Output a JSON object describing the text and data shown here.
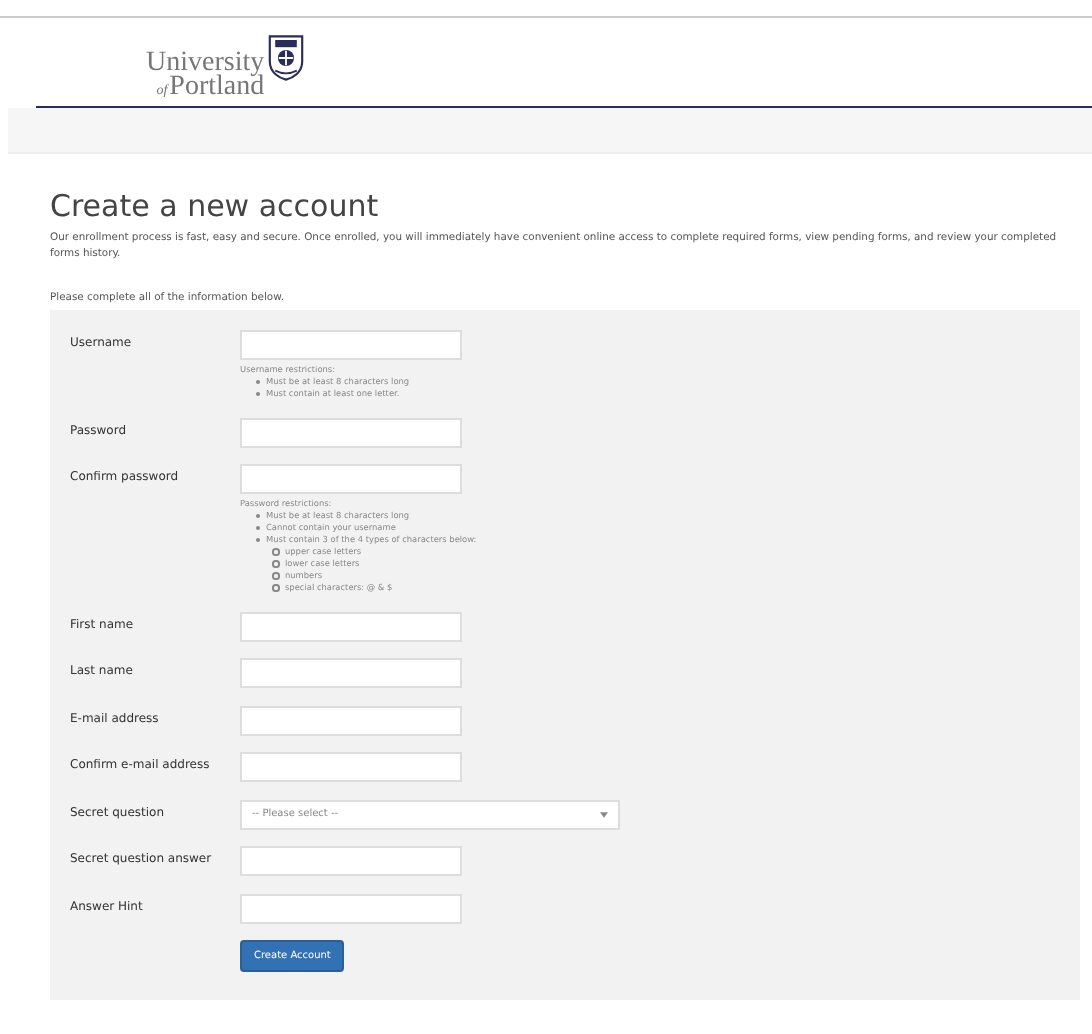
{
  "logo": {
    "line_1": "University",
    "line_2_prefix": "of",
    "line_2": "Portland"
  },
  "page": {
    "title": "Create a new account",
    "intro": "Our enrollment process is fast, easy and secure. Once enrolled, you will immediately have convenient online access to complete required forms, view pending forms, and review your completed forms history.",
    "instruction": "Please complete all of the information below."
  },
  "fields": [
    {
      "label": "Username",
      "kind": "text",
      "notes": {
        "heading": "Username restrictions:",
        "items": [
          {
            "text": "Must be at least 8 characters long"
          },
          {
            "text": "Must contain at least one letter."
          }
        ]
      }
    },
    {
      "label": "Password",
      "kind": "text"
    },
    {
      "label": "Confirm password",
      "kind": "text",
      "notes": {
        "heading": "Password restrictions:",
        "items": [
          {
            "text": "Must be at least 8 characters long"
          },
          {
            "text": "Cannot contain your username"
          },
          {
            "text": "Must contain 3 of the 4 types of characters below:",
            "children": [
              {
                "text": "upper case letters"
              },
              {
                "text": "lower case letters"
              },
              {
                "text": "numbers"
              },
              {
                "text": "special characters: @ & $"
              }
            ]
          }
        ]
      }
    },
    {
      "label": "First name",
      "kind": "text"
    },
    {
      "label": "Last name",
      "kind": "text"
    },
    {
      "label": "E-mail address",
      "kind": "text"
    },
    {
      "label": "Confirm e-mail address",
      "kind": "text"
    },
    {
      "label": "Secret question",
      "kind": "select",
      "placeholder": "-- Please select --"
    },
    {
      "label": "Secret question answer",
      "kind": "text"
    },
    {
      "label": "Answer Hint",
      "kind": "text"
    }
  ],
  "submit": {
    "label": "Create Account"
  }
}
